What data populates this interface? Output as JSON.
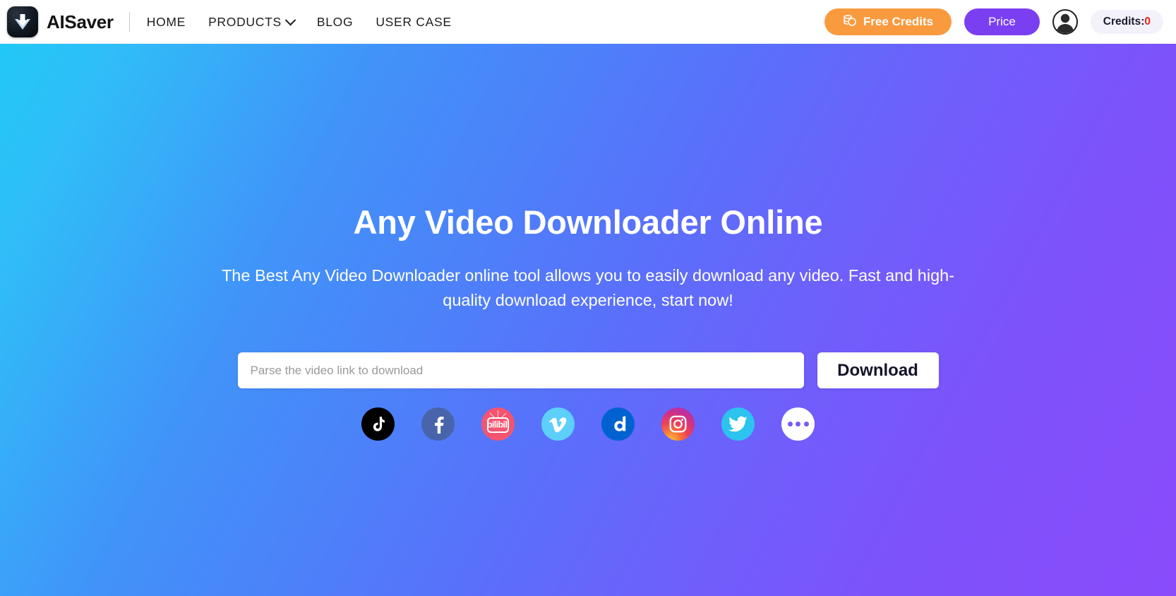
{
  "header": {
    "logo_icon": "download-arrow-logo-icon",
    "brand_name": "AISaver",
    "nav": [
      {
        "label": "HOME",
        "name": "nav-item-home",
        "has_caret": false
      },
      {
        "label": "PRODUCTS",
        "name": "nav-item-products",
        "has_caret": true
      },
      {
        "label": "BLOG",
        "name": "nav-item-blog",
        "has_caret": false
      },
      {
        "label": "USER CASE",
        "name": "nav-item-user-case",
        "has_caret": false
      }
    ],
    "free_credits_label": "Free Credits",
    "free_credits_icon": "coins-icon",
    "free_credits_color": "#f99a3f",
    "price_label": "Price",
    "price_color": "#7b3ff2",
    "avatar_icon": "user-avatar-icon",
    "credits_label": "Credits:",
    "credits_value": "0",
    "credits_value_color": "#f02020"
  },
  "hero": {
    "title": "Any Video Downloader Online",
    "subtitle": "The Best Any Video Downloader online tool allows you to easily download any video. Fast and high-quality download experience, start now!",
    "gradient_start": "#21c8f6",
    "gradient_end": "#8a4bfb",
    "search": {
      "placeholder": "Parse the video link to download",
      "value": ""
    },
    "download_label": "Download",
    "social_icons": [
      {
        "name": "tiktok-icon",
        "label": "TikTok",
        "color": "#000000"
      },
      {
        "name": "facebook-icon",
        "label": "Facebook",
        "color": "#4864ab"
      },
      {
        "name": "bilibili-icon",
        "label": "bilibili",
        "color": "#f4546f"
      },
      {
        "name": "vimeo-icon",
        "label": "Vimeo",
        "color": "#5ccffb"
      },
      {
        "name": "dailymotion-icon",
        "label": "Dailymotion",
        "color": "#0062d1"
      },
      {
        "name": "instagram-icon",
        "label": "Instagram",
        "color": "#c9308e"
      },
      {
        "name": "twitter-icon",
        "label": "Twitter",
        "color": "#2cc3ee"
      },
      {
        "name": "more-icon",
        "label": "More",
        "color": "#ffffff"
      }
    ]
  }
}
